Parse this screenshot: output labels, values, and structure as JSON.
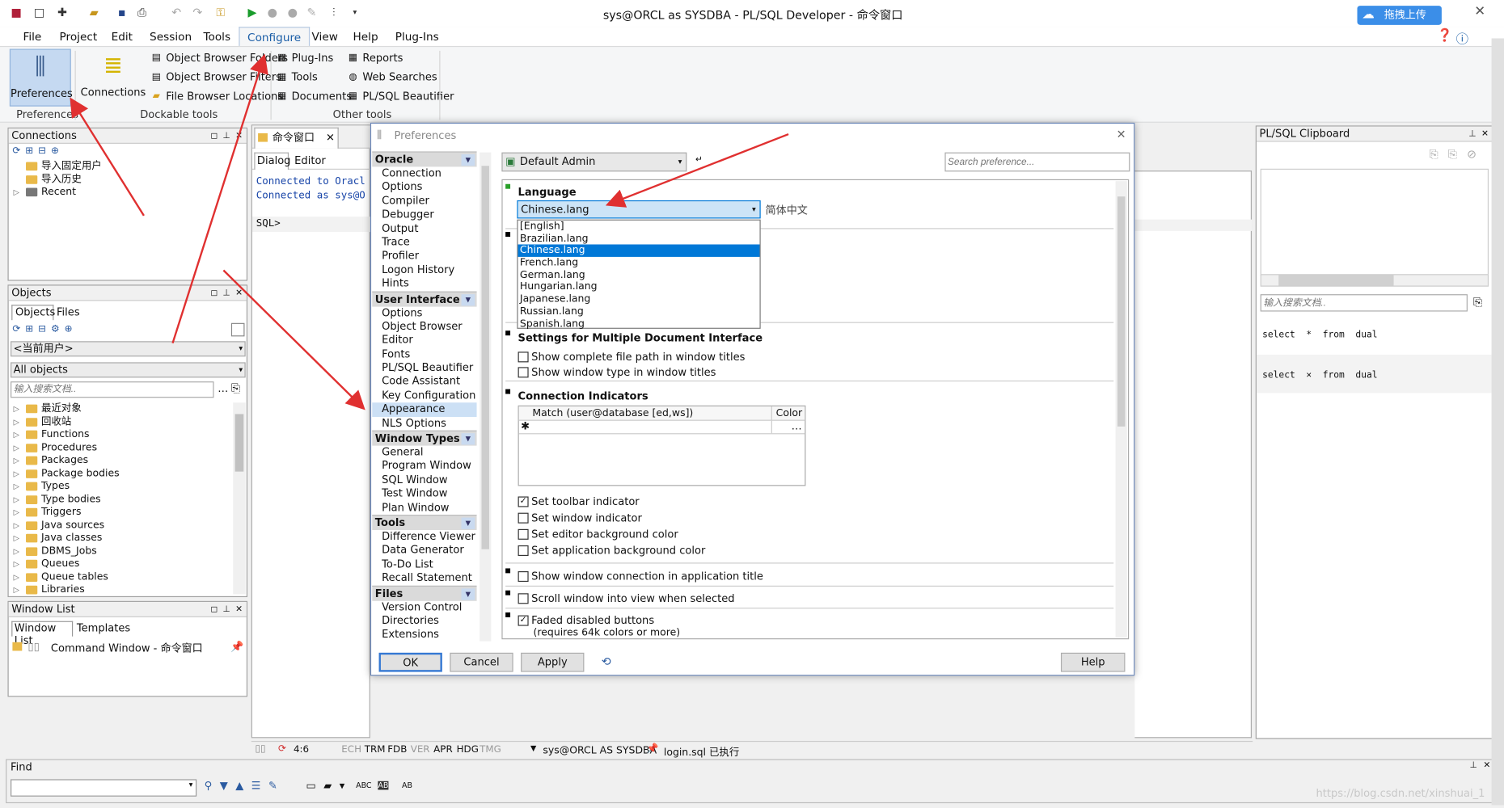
{
  "window": {
    "title": "sys@ORCL as SYSDBA - PL/SQL Developer - 命令窗口",
    "upload_label": "拖拽上传"
  },
  "menu": [
    "File",
    "Project",
    "Edit",
    "Session",
    "Tools",
    "Configure",
    "View",
    "Help",
    "Plug-Ins"
  ],
  "ribbon": {
    "preferences": "Preferences",
    "connections": "Connections",
    "obj_browser_folders": "Object Browser Folders",
    "obj_browser_filters": "Object Browser Filters",
    "file_browser_locations": "File Browser Locations",
    "plugins": "Plug-Ins",
    "tools": "Tools",
    "documents": "Documents",
    "reports": "Reports",
    "web_searches": "Web Searches",
    "beautifier": "PL/SQL Beautifier",
    "grp_preferences": "Preferences",
    "grp_dockable": "Dockable tools",
    "grp_other": "Other tools"
  },
  "connections": {
    "title": "Connections",
    "items": [
      "导入固定用户",
      "导入历史",
      "Recent"
    ]
  },
  "objects": {
    "title": "Objects",
    "tabs": [
      "Objects",
      "Files"
    ],
    "user": "<当前用户>",
    "filter": "All objects",
    "search_placeholder": "输入搜索文档..",
    "items": [
      "最近对象",
      "回收站",
      "Functions",
      "Procedures",
      "Packages",
      "Package bodies",
      "Types",
      "Type bodies",
      "Triggers",
      "Java sources",
      "Java classes",
      "DBMS_Jobs",
      "Queues",
      "Queue tables",
      "Libraries"
    ]
  },
  "windowlist": {
    "title": "Window List",
    "tabs": [
      "Window List",
      "Templates"
    ],
    "item": "Command Window - 命令窗口"
  },
  "editor": {
    "tab": "命令窗口",
    "subtabs": [
      "Dialog",
      "Editor"
    ],
    "lines": [
      "Connected to Oracl",
      "Connected as sys@O"
    ],
    "prompt": "SQL>"
  },
  "status": {
    "pos": "4:6",
    "flags": [
      "ECH",
      "TRM",
      "FDB",
      "VER",
      "APR",
      "HDG",
      "TMG"
    ],
    "conn": "sys@ORCL AS SYSDBA",
    "file": "login.sql 已执行"
  },
  "find": {
    "title": "Find"
  },
  "clipboard": {
    "title": "PL/SQL Clipboard",
    "search_placeholder": "输入搜索文档..",
    "entries": [
      "select  *  from  dual",
      "select  ×  from  dual"
    ]
  },
  "watermark": "https://blog.csdn.net/xinshuai_1",
  "prefs": {
    "title": "Preferences",
    "groups": [
      {
        "name": "Oracle",
        "items": [
          "Connection",
          "Options",
          "Compiler",
          "Debugger",
          "Output",
          "Trace",
          "Profiler",
          "Logon History",
          "Hints"
        ]
      },
      {
        "name": "User Interface",
        "items": [
          "Options",
          "Object Browser",
          "Editor",
          "Fonts",
          "PL/SQL Beautifier",
          "Code Assistant",
          "Key Configuration",
          "Appearance",
          "NLS Options"
        ]
      },
      {
        "name": "Window Types",
        "items": [
          "General",
          "Program Window",
          "SQL Window",
          "Test Window",
          "Plan Window"
        ]
      },
      {
        "name": "Tools",
        "items": [
          "Difference Viewer",
          "Data Generator",
          "To-Do List",
          "Recall Statement"
        ]
      },
      {
        "name": "Files",
        "items": [
          "Version Control",
          "Directories",
          "Extensions"
        ]
      }
    ],
    "selected": "Appearance",
    "profile": "Default Admin",
    "search_placeholder": "Search preference...",
    "language_label": "Language",
    "language_value": "Chinese.lang",
    "language_desc": "简体中文",
    "languages": [
      "[English]",
      "Brazilian.lang",
      "Chinese.lang",
      "French.lang",
      "German.lang",
      "Hungarian.lang",
      "Japanese.lang",
      "Russian.lang",
      "Spanish.lang"
    ],
    "mdi_title": "Settings for Multiple Document Interface",
    "mdi_opts": [
      "Show complete file path in window titles",
      "Show window type in window titles"
    ],
    "conn_title": "Connection Indicators",
    "col_match": "Match (user@database [ed,ws])",
    "col_color": "Color",
    "ind_opts": [
      {
        "label": "Set toolbar indicator",
        "checked": true
      },
      {
        "label": "Set window indicator",
        "checked": false
      },
      {
        "label": "Set editor background color",
        "checked": false
      },
      {
        "label": "Set application background color",
        "checked": false
      }
    ],
    "show_conn": "Show window connection in application title",
    "scroll": "Scroll window into view when selected",
    "faded": "Faded disabled buttons",
    "faded_note": "(requires 64k colors or more)",
    "ok": "OK",
    "cancel": "Cancel",
    "apply": "Apply",
    "help": "Help"
  }
}
